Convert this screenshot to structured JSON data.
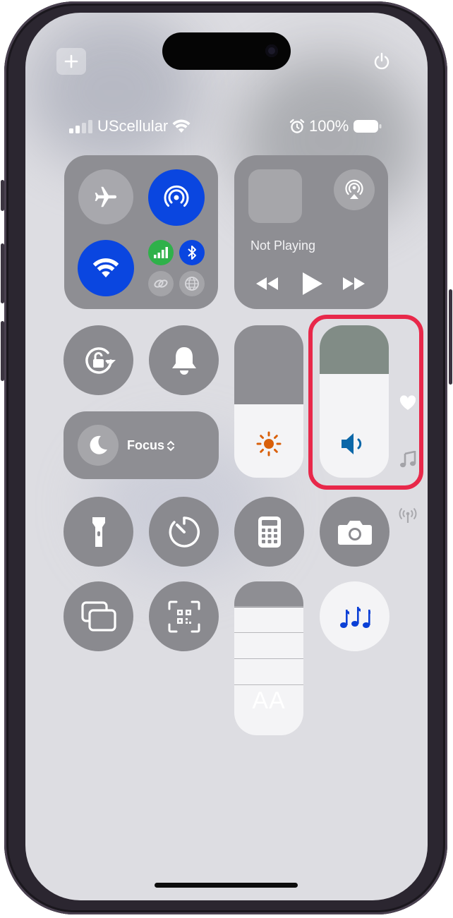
{
  "status_bar": {
    "carrier": "UScellular",
    "battery": "100%"
  },
  "media": {
    "now_playing": "Not Playing"
  },
  "focus": {
    "label": "Focus"
  },
  "text_size": {
    "label": "AA"
  },
  "sliders": {
    "brightness_level": 0.48,
    "volume_level": 0.68,
    "text_size_level": 0.75
  },
  "colors": {
    "accent_blue": "#0a46e0",
    "highlight_red": "#e8284a",
    "music_blue": "#0a3fd6",
    "sun_orange": "#d9600a"
  },
  "icons": [
    "plus-icon",
    "power-icon",
    "airplane-icon",
    "airdrop-icon",
    "wifi-icon",
    "cellular-icon",
    "bluetooth-icon",
    "link-icon",
    "globe-icon",
    "airplay-icon",
    "rewind-icon",
    "play-icon",
    "fast-forward-icon",
    "rotation-lock-icon",
    "bell-icon",
    "moon-icon",
    "chevron-updown-icon",
    "sun-icon",
    "speaker-icon",
    "heart-icon",
    "music-note-icon",
    "antenna-icon",
    "flashlight-icon",
    "timer-icon",
    "calculator-icon",
    "camera-icon",
    "screen-mirroring-icon",
    "qr-code-icon",
    "music-recognition-icon"
  ]
}
